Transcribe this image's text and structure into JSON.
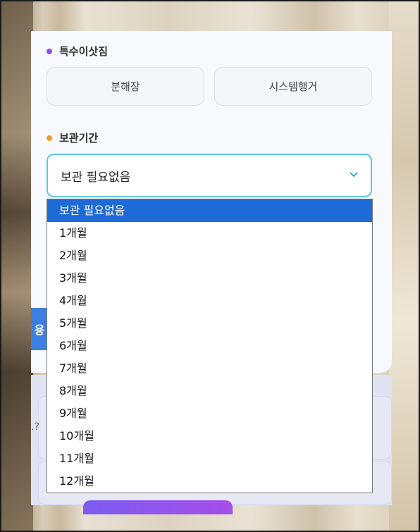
{
  "sections": {
    "special_items": {
      "title": "특수이삿짐",
      "dot_color": "#8b4fe8",
      "options": [
        "분해장",
        "시스템행거"
      ]
    },
    "storage": {
      "title": "보관기간",
      "dot_color": "#f0a020",
      "selected_value": "보관 필요없음"
    }
  },
  "dropdown": {
    "options": [
      "보관 필요없음",
      "1개월",
      "2개월",
      "3개월",
      "4개월",
      "5개월",
      "6개월",
      "7개월",
      "8개월",
      "9개월",
      "10개월",
      "11개월",
      "12개월"
    ],
    "selected_index": 0
  },
  "background": {
    "side_tab_label": "용",
    "partial_text": ".?"
  },
  "colors": {
    "accent": "#5fc6e6",
    "highlight": "#1e6ad6",
    "side_tab": "#3d7fe0"
  }
}
